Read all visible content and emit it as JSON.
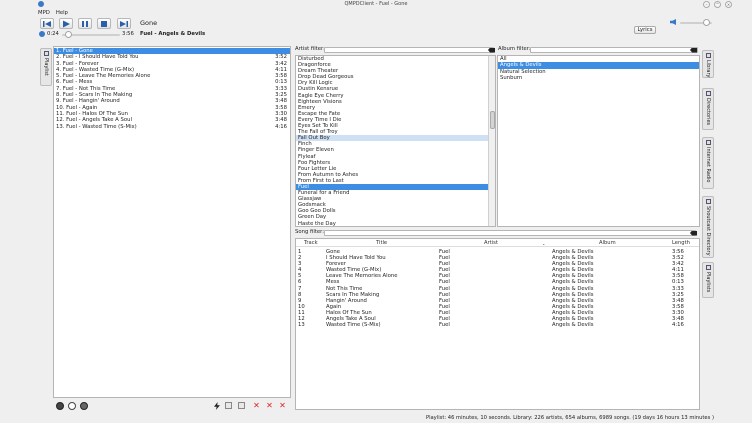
{
  "window": {
    "title": "QMPDClient - Fuel - Gone"
  },
  "menu": {
    "mpd": "MPD",
    "help": "Help"
  },
  "player": {
    "current_song": "Gone",
    "elapsed": "0:24",
    "total": "3:56",
    "now_playing_artist_album": "Fuel - Angels & Devils",
    "lyrics_button": "Lyrics",
    "progress_fraction": 0.1
  },
  "left_tab": {
    "label": "Playlist"
  },
  "playlist": [
    {
      "title": "1. Fuel - Gone",
      "time": "",
      "selected": true
    },
    {
      "title": "2. Fuel - I Should Have Told You",
      "time": "3:52"
    },
    {
      "title": "3. Fuel - Forever",
      "time": "3:42"
    },
    {
      "title": "4. Fuel - Wasted Time (G-Mix)",
      "time": "4:11"
    },
    {
      "title": "5. Fuel - Leave The Memories Alone",
      "time": "3:58"
    },
    {
      "title": "6. Fuel - Mess",
      "time": "0:13"
    },
    {
      "title": "7. Fuel - Not This Time",
      "time": "3:33"
    },
    {
      "title": "8. Fuel - Scars In The Making",
      "time": "3:25"
    },
    {
      "title": "9. Fuel - Hangin' Around",
      "time": "3:48"
    },
    {
      "title": "10. Fuel - Again",
      "time": "3:58"
    },
    {
      "title": "11. Fuel - Halos Of The Sun",
      "time": "3:30"
    },
    {
      "title": "12. Fuel - Angels Take A Soul",
      "time": "3:48"
    },
    {
      "title": "13. Fuel - Wasted Time (S-Mix)",
      "time": "4:16"
    }
  ],
  "artist_filter": {
    "label": "Artist filter:",
    "value": ""
  },
  "album_filter": {
    "label": "Album filter:",
    "value": ""
  },
  "song_filter": {
    "label": "Song filter:",
    "value": ""
  },
  "artists": [
    {
      "name": "Disturbed"
    },
    {
      "name": "Dragonforce"
    },
    {
      "name": "Dream Theater"
    },
    {
      "name": "Drop Dead Gorgeous"
    },
    {
      "name": "Dry Kill Logic"
    },
    {
      "name": "Dustin Kensrue"
    },
    {
      "name": "Eagle Eye Cherry"
    },
    {
      "name": "Eighteen Visions"
    },
    {
      "name": "Emery"
    },
    {
      "name": "Escape the Fate"
    },
    {
      "name": "Every Time I Die"
    },
    {
      "name": "Eyes Set To Kill"
    },
    {
      "name": "The Fall of Troy"
    },
    {
      "name": "Fall Out Boy",
      "hover": true
    },
    {
      "name": "Finch"
    },
    {
      "name": "Finger Eleven"
    },
    {
      "name": "Flyleaf"
    },
    {
      "name": "Foo Fighters"
    },
    {
      "name": "Four Letter Lie"
    },
    {
      "name": "From Autumn to Ashes"
    },
    {
      "name": "From First to Last"
    },
    {
      "name": "Fuel",
      "selected": true
    },
    {
      "name": "Funeral for a Friend"
    },
    {
      "name": "Glassjaw"
    },
    {
      "name": "Godsmack"
    },
    {
      "name": "Goo Goo Dolls"
    },
    {
      "name": "Green Day"
    },
    {
      "name": "Haste the Day"
    }
  ],
  "albums": [
    {
      "name": "All"
    },
    {
      "name": "Angels & Devils",
      "selected": true
    },
    {
      "name": "Natural Selection"
    },
    {
      "name": "Sunburn"
    }
  ],
  "song_table": {
    "headers": {
      "track": "Track",
      "title": "Title",
      "artist": "Artist",
      "album": "Album",
      "length": "Length"
    },
    "rows": [
      {
        "track": "1",
        "title": "Gone",
        "artist": "Fuel",
        "album": "Angels & Devils",
        "length": "3:56"
      },
      {
        "track": "2",
        "title": "I Should Have Told You",
        "artist": "Fuel",
        "album": "Angels & Devils",
        "length": "3:52"
      },
      {
        "track": "3",
        "title": "Forever",
        "artist": "Fuel",
        "album": "Angels & Devils",
        "length": "3:42"
      },
      {
        "track": "4",
        "title": "Wasted Time (G-Mix)",
        "artist": "Fuel",
        "album": "Angels & Devils",
        "length": "4:11"
      },
      {
        "track": "5",
        "title": "Leave The Memories Alone",
        "artist": "Fuel",
        "album": "Angels & Devils",
        "length": "3:58"
      },
      {
        "track": "6",
        "title": "Mess",
        "artist": "Fuel",
        "album": "Angels & Devils",
        "length": "0:13"
      },
      {
        "track": "7",
        "title": "Not This Time",
        "artist": "Fuel",
        "album": "Angels & Devils",
        "length": "3:33"
      },
      {
        "track": "8",
        "title": "Scars In The Making",
        "artist": "Fuel",
        "album": "Angels & Devils",
        "length": "3:25"
      },
      {
        "track": "9",
        "title": "Hangin' Around",
        "artist": "Fuel",
        "album": "Angels & Devils",
        "length": "3:48"
      },
      {
        "track": "10",
        "title": "Again",
        "artist": "Fuel",
        "album": "Angels & Devils",
        "length": "3:58"
      },
      {
        "track": "11",
        "title": "Halos Of The Sun",
        "artist": "Fuel",
        "album": "Angels & Devils",
        "length": "3:30"
      },
      {
        "track": "12",
        "title": "Angels Take A Soul",
        "artist": "Fuel",
        "album": "Angels & Devils",
        "length": "3:48"
      },
      {
        "track": "13",
        "title": "Wasted Time (S-Mix)",
        "artist": "Fuel",
        "album": "Angels & Devils",
        "length": "4:16"
      }
    ]
  },
  "right_tabs": [
    {
      "label": "Library"
    },
    {
      "label": "Directories"
    },
    {
      "label": "Internet Radio"
    },
    {
      "label": "Shoutcast Directory"
    },
    {
      "label": "Playlists"
    }
  ],
  "status_bar": "Playlist: 46 minutes, 10 seconds. Library: 226 artists, 654 albums, 6989 songs. (19 days 16 hours 13 minutes )",
  "colors": {
    "selection": "#3d8ee3",
    "hover": "#cfe0f5",
    "delete": "#dd2222"
  }
}
